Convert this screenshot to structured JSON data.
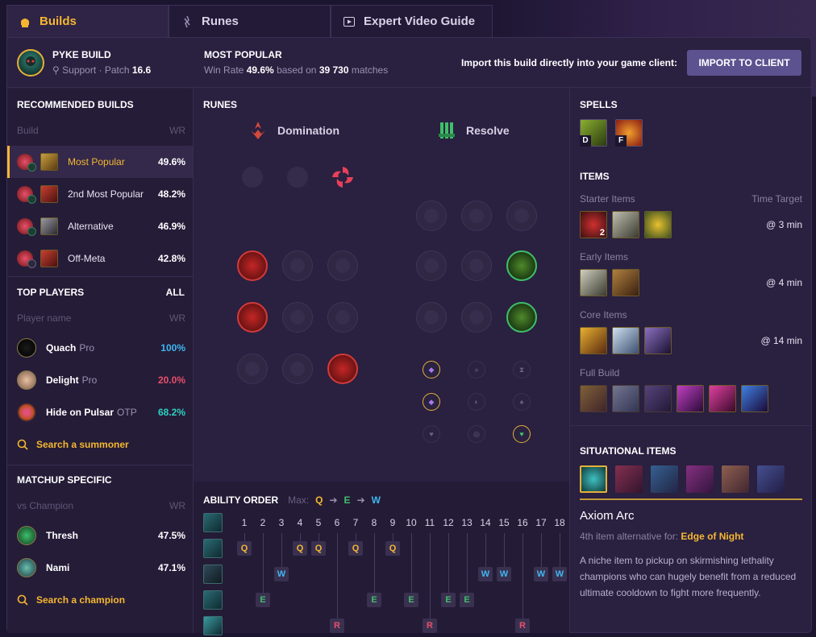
{
  "tabs": [
    {
      "label": "Builds",
      "icon": "helmet-icon",
      "active": true
    },
    {
      "label": "Runes",
      "icon": "rune-icon",
      "active": false
    },
    {
      "label": "Expert Video Guide",
      "icon": "video-icon",
      "active": false
    }
  ],
  "header": {
    "build_title": "PYKE BUILD",
    "role": "Support",
    "patch_label": "· Patch",
    "patch": "16.6",
    "popular_title": "MOST POPULAR",
    "win_rate_label": "Win Rate",
    "win_rate": "49.6%",
    "based_on": "based on",
    "matches": "39 730",
    "matches_label": "matches",
    "import_text": "Import this build directly into your game client:",
    "import_button": "IMPORT TO CLIENT"
  },
  "recommended": {
    "title": "RECOMMENDED BUILDS",
    "col_build": "Build",
    "col_wr": "WR",
    "builds": [
      {
        "name": "Most Popular",
        "wr": "49.6%"
      },
      {
        "name": "2nd Most Popular",
        "wr": "48.2%"
      },
      {
        "name": "Alternative",
        "wr": "46.9%"
      },
      {
        "name": "Off-Meta",
        "wr": "42.8%"
      }
    ]
  },
  "top_players": {
    "title": "TOP PLAYERS",
    "all_label": "ALL",
    "col_name": "Player name",
    "col_wr": "WR",
    "players": [
      {
        "name": "Quach",
        "tag": "Pro",
        "wr": "100%",
        "color": "#3fb7f0"
      },
      {
        "name": "Delight",
        "tag": "Pro",
        "wr": "20.0%",
        "color": "#e8506a"
      },
      {
        "name": "Hide on Pulsar",
        "tag": "OTP",
        "wr": "68.2%",
        "color": "#2fd0c0"
      }
    ],
    "search_label": "Search a summoner"
  },
  "matchup": {
    "title": "MATCHUP SPECIFIC",
    "col_vs": "vs Champion",
    "col_wr": "WR",
    "champions": [
      {
        "name": "Thresh",
        "wr": "47.5%"
      },
      {
        "name": "Nami",
        "wr": "47.1%"
      }
    ],
    "search_label": "Search a champion"
  },
  "runes": {
    "title": "RUNES",
    "primary": "Domination",
    "secondary": "Resolve"
  },
  "ability_order": {
    "title": "ABILITY ORDER",
    "max_label": "Max:",
    "max_order": [
      "Q",
      "E",
      "W"
    ],
    "levels": [
      "1",
      "2",
      "3",
      "4",
      "5",
      "6",
      "7",
      "8",
      "9",
      "10",
      "11",
      "12",
      "13",
      "14",
      "15",
      "16",
      "17",
      "18"
    ],
    "sequence": [
      "Q",
      "E",
      "W",
      "Q",
      "Q",
      "R",
      "Q",
      "E",
      "Q",
      "E",
      "R",
      "E",
      "E",
      "W",
      "W",
      "R",
      "W",
      "W"
    ]
  },
  "spells": {
    "title": "SPELLS",
    "keys": [
      "D",
      "F"
    ]
  },
  "items": {
    "title": "ITEMS",
    "starter_label": "Starter Items",
    "time_target_label": "Time Target",
    "starter_time": "@ 3 min",
    "starter_count": "2",
    "early_label": "Early Items",
    "early_time": "@ 4 min",
    "core_label": "Core Items",
    "core_time": "@ 14 min",
    "full_label": "Full Build"
  },
  "situational": {
    "title": "SITUATIONAL ITEMS",
    "item_name": "Axiom Arc",
    "alt_label": "4th item alternative for:",
    "alt_item": "Edge of Night",
    "description": "A niche item to pickup on skirmishing lethality champions who can hugely benefit from a reduced ultimate cooldown to fight more frequently."
  },
  "colors": {
    "accent": "#f5b731",
    "q": "#f5b731",
    "w": "#3fb7f0",
    "e": "#3fbf6a",
    "r": "#e8506a",
    "background": "#1c1530"
  }
}
